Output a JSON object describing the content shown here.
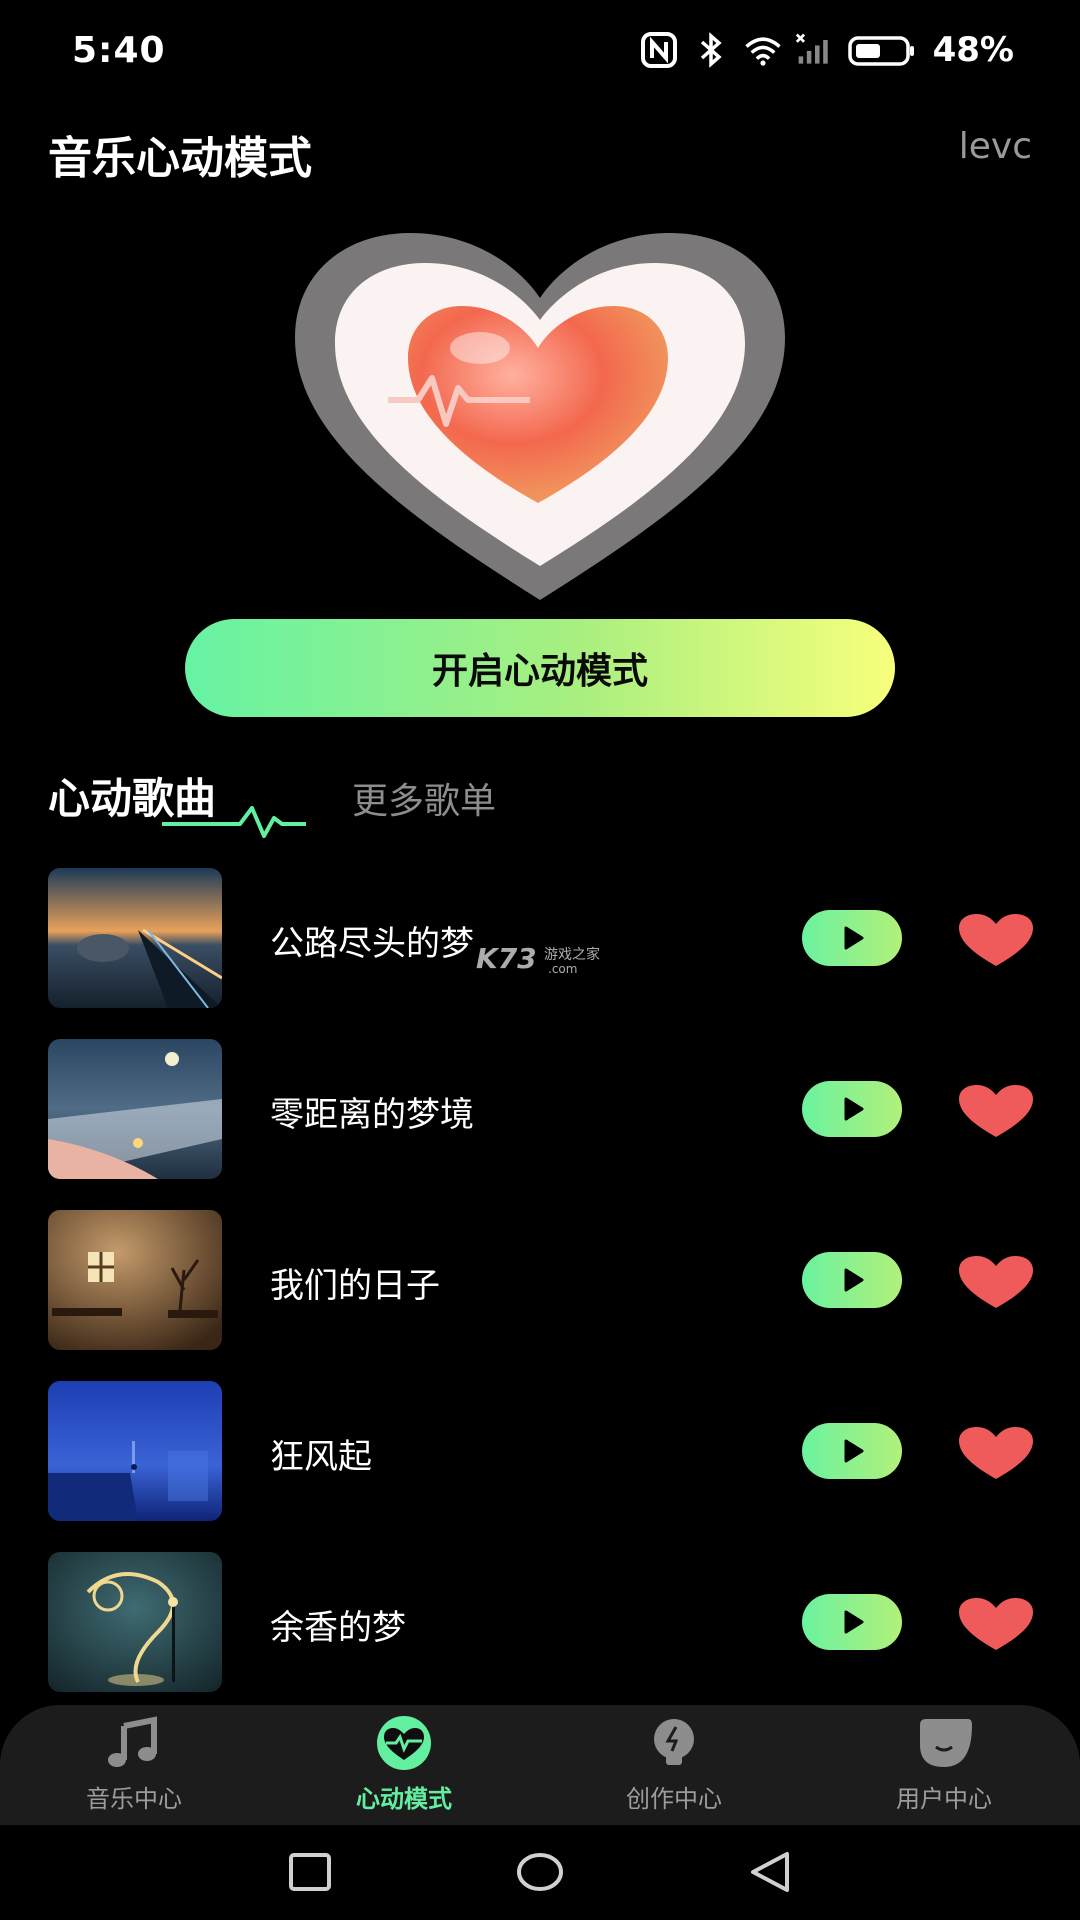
{
  "status_bar": {
    "time": "5:40",
    "battery": "48%"
  },
  "header": {
    "title": "音乐心动模式",
    "user": "levc"
  },
  "start_button": {
    "label": "开启心动模式"
  },
  "tabs": {
    "active": "心动歌曲",
    "inactive": "更多歌单"
  },
  "songs": [
    {
      "title": "公路尽头的梦"
    },
    {
      "title": "零距离的梦境"
    },
    {
      "title": "我们的日子"
    },
    {
      "title": "狂风起"
    },
    {
      "title": "余香的梦"
    }
  ],
  "watermark": {
    "brand": "K73",
    "tagline": "游戏之家",
    "domain": ".com"
  },
  "bottom_nav": [
    {
      "label": "音乐中心",
      "icon": "music-note-icon"
    },
    {
      "label": "心动模式",
      "icon": "heartbeat-icon",
      "active": true
    },
    {
      "label": "创作中心",
      "icon": "bulb-icon"
    },
    {
      "label": "用户中心",
      "icon": "smile-icon"
    }
  ],
  "colors": {
    "accent_green": "#62f0a0",
    "accent_yellow": "#f7ff7c",
    "like_red": "#ef5b5b",
    "background": "#000000"
  }
}
